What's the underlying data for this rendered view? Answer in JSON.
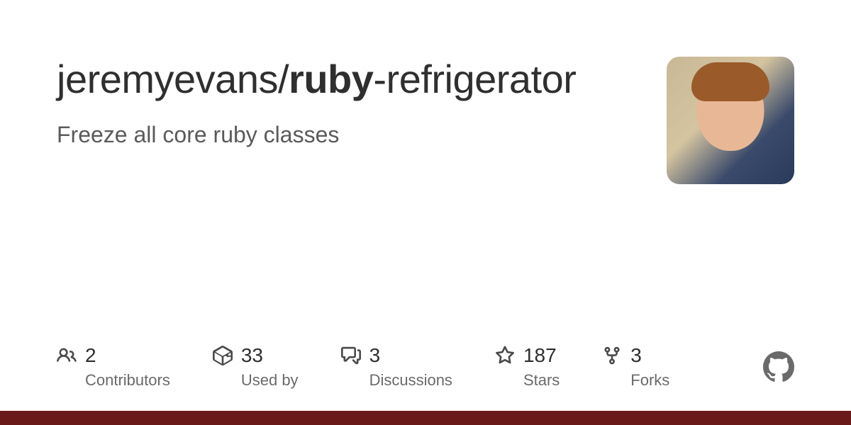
{
  "repo": {
    "owner": "jeremyevans",
    "separator": "/",
    "name_bold": "ruby",
    "name_rest": "-refrigerator",
    "description": "Freeze all core ruby classes"
  },
  "stats": {
    "contributors": {
      "value": "2",
      "label": "Contributors"
    },
    "used_by": {
      "value": "33",
      "label": "Used by"
    },
    "discussions": {
      "value": "3",
      "label": "Discussions"
    },
    "stars": {
      "value": "187",
      "label": "Stars"
    },
    "forks": {
      "value": "3",
      "label": "Forks"
    }
  }
}
